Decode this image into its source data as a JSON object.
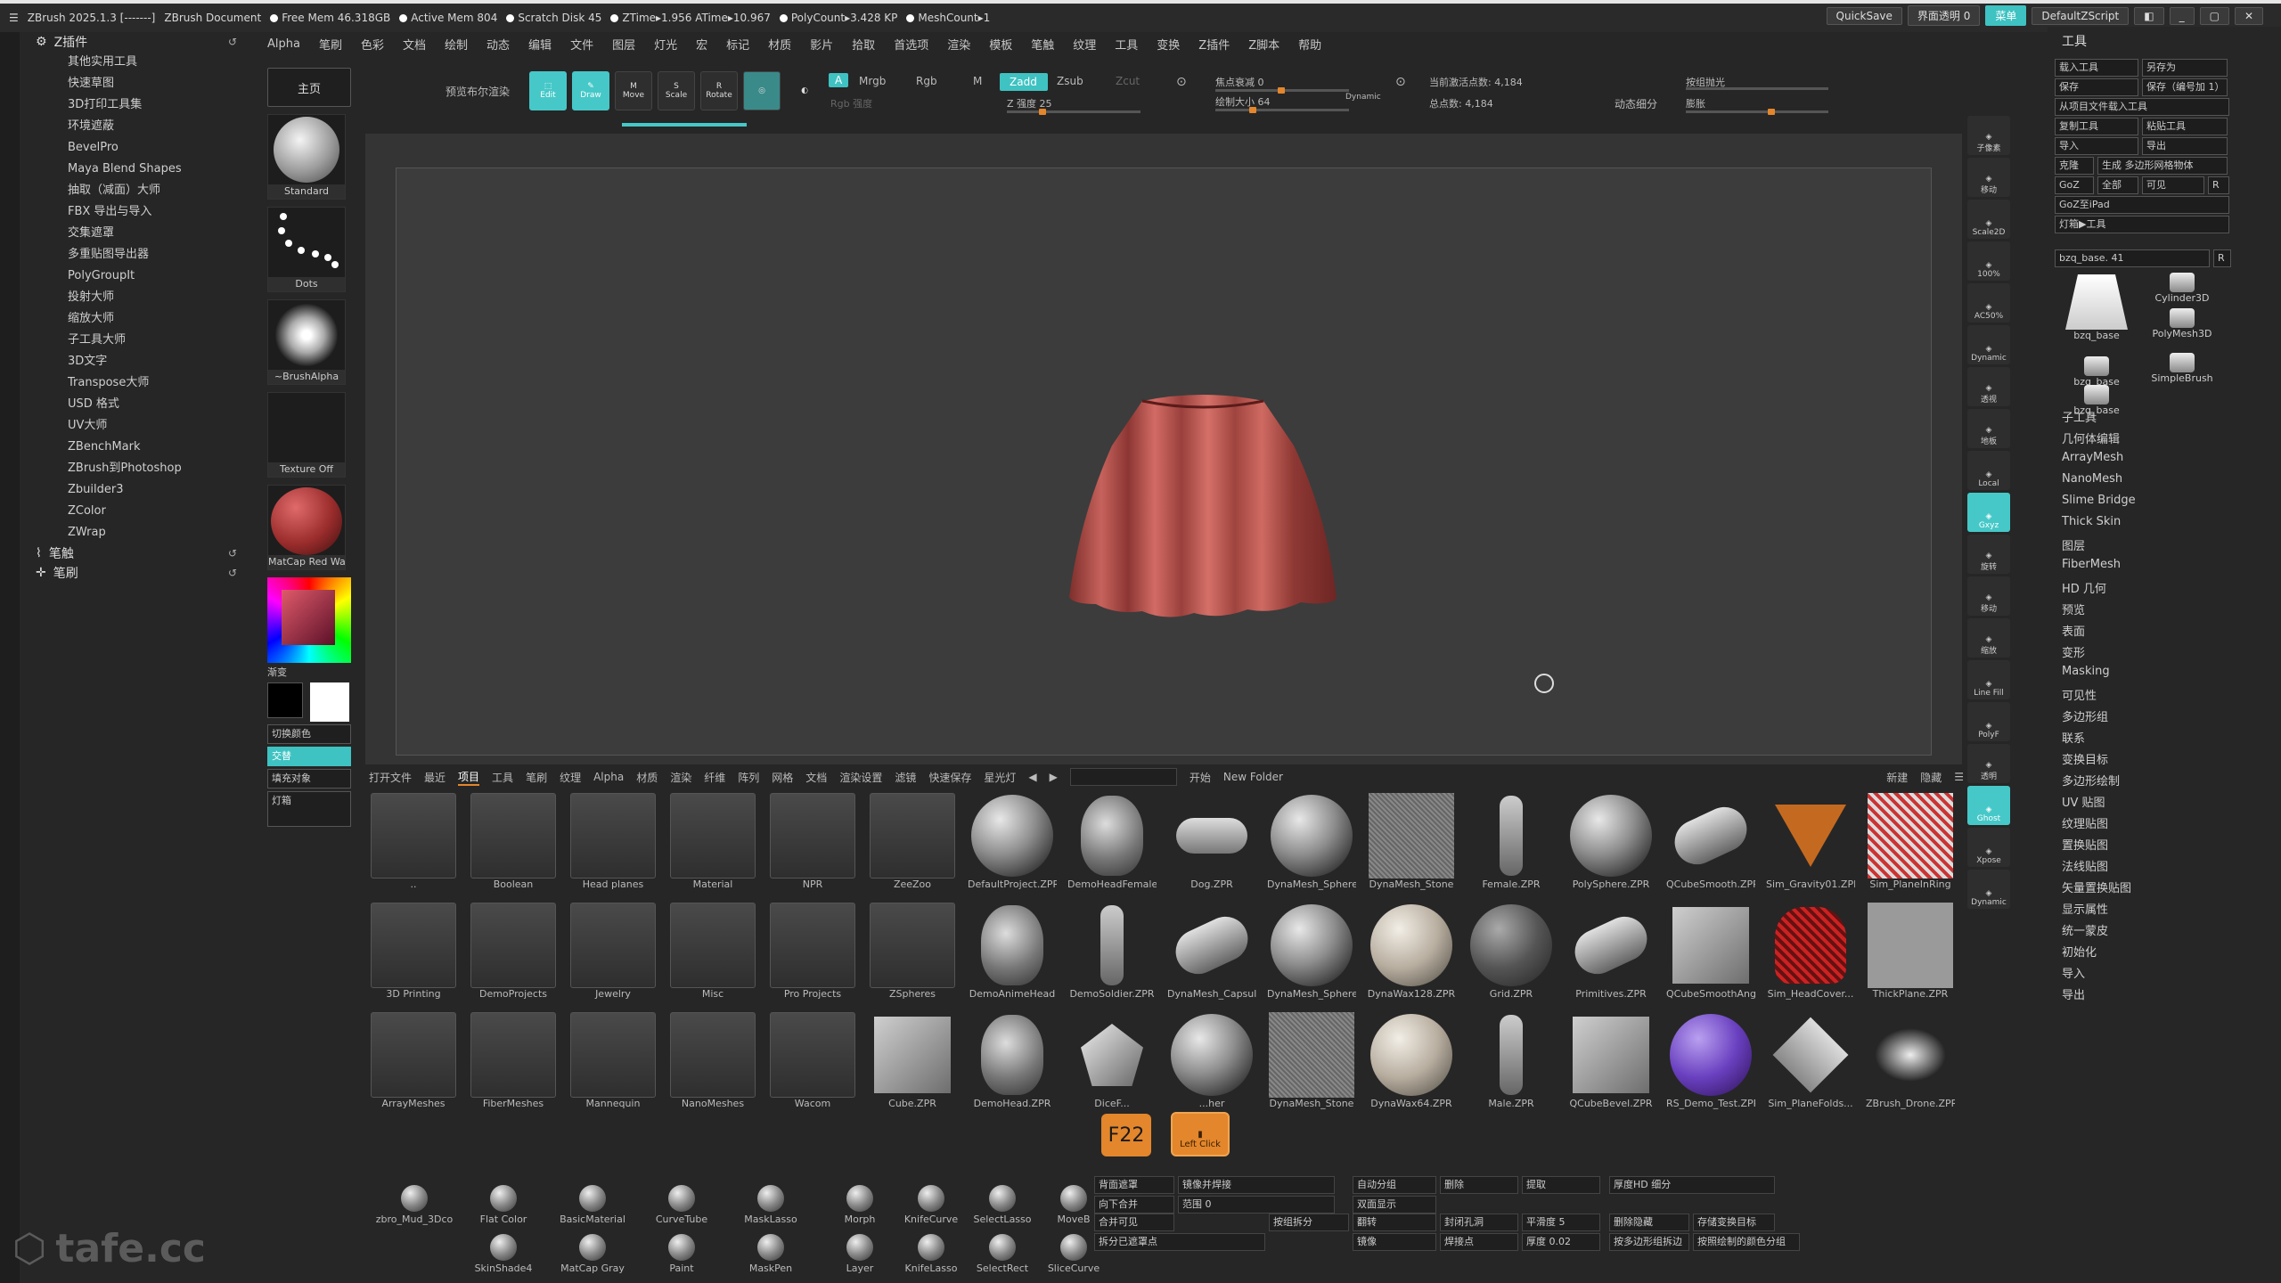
{
  "titlebar": {
    "app": "ZBrush 2025.1.3 [-------]",
    "doc": "ZBrush Document",
    "free_mem": "Free Mem 46.318GB",
    "active_mem": "Active Mem 804",
    "scratch": "Scratch Disk 45",
    "ztime": "ZTime▸1.956 ATime▸10.967",
    "polycount": "PolyCount▸3.428 KP",
    "meshcount": "MeshCount▸1",
    "quicksave": "QuickSave",
    "transparency": "界面透明 0",
    "menus_btn": "菜单",
    "script": "DefaultZScript"
  },
  "menubar": [
    "Alpha",
    "笔刷",
    "色彩",
    "文档",
    "绘制",
    "动态",
    "编辑",
    "文件",
    "图层",
    "灯光",
    "宏",
    "标记",
    "材质",
    "影片",
    "拾取",
    "首选项",
    "渲染",
    "模板",
    "笔触",
    "纹理",
    "工具",
    "变换",
    "Z插件",
    "Z脚本",
    "帮助"
  ],
  "leftpanel": {
    "header": "Z插件",
    "items": [
      "其他实用工具",
      "快速草图",
      "3D打印工具集",
      "环境遮蔽",
      "BevelPro",
      "Maya Blend Shapes",
      "抽取（减面）大师",
      "FBX 导出与导入",
      "交集遮罩",
      "多重贴图导出器",
      "PolyGroupIt",
      "投射大师",
      "缩放大师",
      "子工具大师",
      "3D文字",
      "Transpose大师",
      "USD 格式",
      "UV大师",
      "ZBenchMark",
      "ZBrush到Photoshop",
      "Zbuilder3",
      "ZColor",
      "ZWrap"
    ],
    "section2": "笔触",
    "section3": "笔刷"
  },
  "tray": {
    "home": "主页",
    "brush": "Standard",
    "stroke": "Dots",
    "alpha": "~BrushAlpha",
    "texture": "Texture Off",
    "material": "MatCap Red Wa",
    "gradient": "渐变",
    "switch_color": "切换颜色",
    "swap": "交替",
    "fill": "填充对象",
    "lightbox": "灯箱"
  },
  "topbar": {
    "preview_bool": "预览布尔渲染",
    "edit": "Edit",
    "draw": "Draw",
    "move": "Move",
    "scale": "Scale",
    "rotate": "Rotate",
    "a": "A",
    "mrgb": "Mrgb",
    "rgb": "Rgb",
    "m": "M",
    "zadd": "Zadd",
    "zsub": "Zsub",
    "zcut": "Zcut",
    "rgb_intensity": "Rgb 强度",
    "z_intensity": "Z 强度 25",
    "focal_shift": "焦点衰减 0",
    "draw_size": "绘制大小 64",
    "dynamic": "Dynamic",
    "active_points": "当前激活点数: 4,184",
    "total_points": "总点数: 4,184",
    "dyn_subdiv": "动态细分",
    "backface": "按组抛光",
    "ripple": "膨胀"
  },
  "lightbox_tabs": [
    "打开文件",
    "最近",
    "项目",
    "工具",
    "笔刷",
    "纹理",
    "Alpha",
    "材质",
    "渲染",
    "纤维",
    "阵列",
    "网格",
    "文档",
    "渲染设置",
    "滤镜",
    "快速保存",
    "星光灯"
  ],
  "lightbox_right": {
    "open": "开始",
    "new_folder": "New Folder",
    "new": "新建",
    "hide": "隐藏"
  },
  "lightbox_items": [
    {
      "label": "..",
      "kind": "folder"
    },
    {
      "label": "Boolean",
      "kind": "folder"
    },
    {
      "label": "Head planes",
      "kind": "folder"
    },
    {
      "label": "Material",
      "kind": "folder"
    },
    {
      "label": "NPR",
      "kind": "folder"
    },
    {
      "label": "ZeeZoo",
      "kind": "folder"
    },
    {
      "label": "DefaultProject.ZPR",
      "kind": "sphere"
    },
    {
      "label": "DemoHeadFemale",
      "kind": "head"
    },
    {
      "label": "Dog.ZPR",
      "kind": "dog"
    },
    {
      "label": "DynaMesh_Sphere",
      "kind": "sphere"
    },
    {
      "label": "DynaMesh_Stone",
      "kind": "stone"
    },
    {
      "label": "Female.ZPR",
      "kind": "figure"
    },
    {
      "label": "PolySphere.ZPR",
      "kind": "sphere"
    },
    {
      "label": "QCubeSmooth.ZPR",
      "kind": "cyl"
    },
    {
      "label": "Sim_Gravity01.ZPR",
      "kind": "orange"
    },
    {
      "label": "Sim_PlaneInRing",
      "kind": "plane"
    },
    {
      "label": "3D Printing",
      "kind": "folder"
    },
    {
      "label": "DemoProjects",
      "kind": "folder"
    },
    {
      "label": "Jewelry",
      "kind": "folder"
    },
    {
      "label": "Misc",
      "kind": "folder"
    },
    {
      "label": "Pro Projects",
      "kind": "folder"
    },
    {
      "label": "ZSpheres",
      "kind": "folder"
    },
    {
      "label": "DemoAnimeHead",
      "kind": "head"
    },
    {
      "label": "DemoSoldier.ZPR",
      "kind": "figure"
    },
    {
      "label": "DynaMesh_Capsule",
      "kind": "cyl"
    },
    {
      "label": "DynaMesh_Sphere",
      "kind": "sphere"
    },
    {
      "label": "DynaWax128.ZPR",
      "kind": "wax"
    },
    {
      "label": "Grid.ZPR",
      "kind": "dark"
    },
    {
      "label": "Primitives.ZPR",
      "kind": "cyl"
    },
    {
      "label": "QCubeSmoothAngle",
      "kind": "box"
    },
    {
      "label": "Sim_HeadCover...",
      "kind": "red"
    },
    {
      "label": "ThickPlane.ZPR",
      "kind": "plane2"
    },
    {
      "label": "ArrayMeshes",
      "kind": "folder"
    },
    {
      "label": "FiberMeshes",
      "kind": "folder"
    },
    {
      "label": "Mannequin",
      "kind": "folder"
    },
    {
      "label": "NanoMeshes",
      "kind": "folder"
    },
    {
      "label": "Wacom",
      "kind": "folder"
    },
    {
      "label": "Cube.ZPR",
      "kind": "box"
    },
    {
      "label": "DemoHead.ZPR",
      "kind": "head"
    },
    {
      "label": "DiceF...",
      "kind": "dice"
    },
    {
      "label": "...her",
      "kind": "sphere"
    },
    {
      "label": "DynaMesh_Stone",
      "kind": "stone"
    },
    {
      "label": "DynaWax64.ZPR",
      "kind": "wax"
    },
    {
      "label": "Male.ZPR",
      "kind": "figure"
    },
    {
      "label": "QCubeBevel.ZPR",
      "kind": "box"
    },
    {
      "label": "RS_Demo_Test.ZPR",
      "kind": "purple"
    },
    {
      "label": "Sim_PlaneFolds...",
      "kind": "diamond"
    },
    {
      "label": "ZBrush_Drone.ZPR",
      "kind": "drone"
    }
  ],
  "keys": {
    "f22": "F22",
    "left_click": "Left Click"
  },
  "brushes": [
    {
      "label": "zbro_Mud_3Dco"
    },
    {
      "label": "Flat Color"
    },
    {
      "label": "BasicMaterial"
    },
    {
      "label": "CurveTube"
    },
    {
      "label": "MaskLasso"
    },
    {
      "label": "Morph"
    },
    {
      "label": "KnifeCurve"
    },
    {
      "label": "SelectLasso"
    },
    {
      "label": "MoveB"
    },
    {
      "label": "SkinShade4"
    },
    {
      "label": "MatCap Gray"
    },
    {
      "label": "Paint"
    },
    {
      "label": "MaskPen"
    },
    {
      "label": "Layer"
    },
    {
      "label": "KnifeLasso"
    },
    {
      "label": "SelectRect"
    },
    {
      "label": "SliceCurve"
    }
  ],
  "bottom_grid": {
    "c1": "背面遮罩",
    "c2": "镜像并焊接",
    "c3": "自动分组",
    "c4": "删除",
    "c5": "提取",
    "c6": "厚度HD 细分",
    "c7": "向下合并",
    "c8": "范围 0",
    "c9": "双面显示",
    "c10": "封闭孔洞",
    "c11": "平滑度 5",
    "c12": "删除隐藏",
    "c13": "存储变换目标",
    "c14": "合并可见",
    "c15": "按组拆分",
    "c16": "翻转",
    "c17": "厚度 0.02",
    "c18": "按多边形组拆边",
    "c19": "按照绘制的颜色分组",
    "c20": "拆分已遮罩点",
    "c21": "镜像",
    "c22": "焊接点"
  },
  "watermark": "tafe.cc",
  "rightshelf": [
    "子像素",
    "移动",
    "Scale2D",
    "100%",
    "AC50%",
    "Dynamic",
    "透视",
    "地板",
    "Local",
    "Gxyz",
    "旋转",
    "移动",
    "缩放",
    "Line Fill",
    "PolyF",
    "透明",
    "Ghost",
    "Xpose",
    "Dynamic"
  ],
  "rightpanel": {
    "title": "工具",
    "buttons": [
      "载入工具",
      "另存为",
      "保存",
      "保存（编号加 1）",
      "从项目文件载入工具",
      "复制工具",
      "粘贴工具",
      "导入",
      "导出",
      "克隆",
      "生成 多边形网格物体",
      "GoZ",
      "全部",
      "可见",
      "R",
      "GoZ至iPad",
      "灯箱▶工具"
    ],
    "current": "bzq_base. 41",
    "thumbs": [
      "bzq_base",
      "Cylinder3D",
      "bzq_base",
      "PolyMesh3D",
      "bzq_base",
      "SimpleBrush"
    ],
    "items": [
      "子工具",
      "几何体编辑",
      "ArrayMesh",
      "NanoMesh",
      "Slime Bridge",
      "Thick Skin",
      "图层",
      "FiberMesh",
      "HD 几何",
      "预览",
      "表面",
      "变形",
      "Masking",
      "可见性",
      "多边形组",
      "联系",
      "变换目标",
      "多边形绘制",
      "UV 贴图",
      "纹理贴图",
      "置换贴图",
      "法线贴图",
      "矢量置换贴图",
      "显示属性",
      "统一蒙皮",
      "初始化",
      "导入",
      "导出"
    ]
  }
}
